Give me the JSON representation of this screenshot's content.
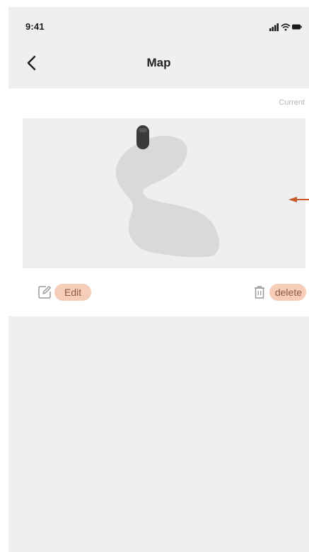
{
  "status_bar": {
    "time": "9:41",
    "signal_icon": "signal-icon",
    "wifi_icon": "wifi-icon",
    "battery_icon": "battery-icon"
  },
  "nav": {
    "back_icon": "chevron-left-icon",
    "title": "Map"
  },
  "map_card": {
    "current_label": "Current",
    "edit_label": "Edit",
    "delete_label": "delete",
    "edit_icon": "edit-icon",
    "delete_icon": "trash-icon"
  },
  "colors": {
    "accent_pill": "#f6cdb8",
    "pointer": "#c85a2a",
    "map_floor": "#d9d9d9",
    "background": "#efefef"
  }
}
